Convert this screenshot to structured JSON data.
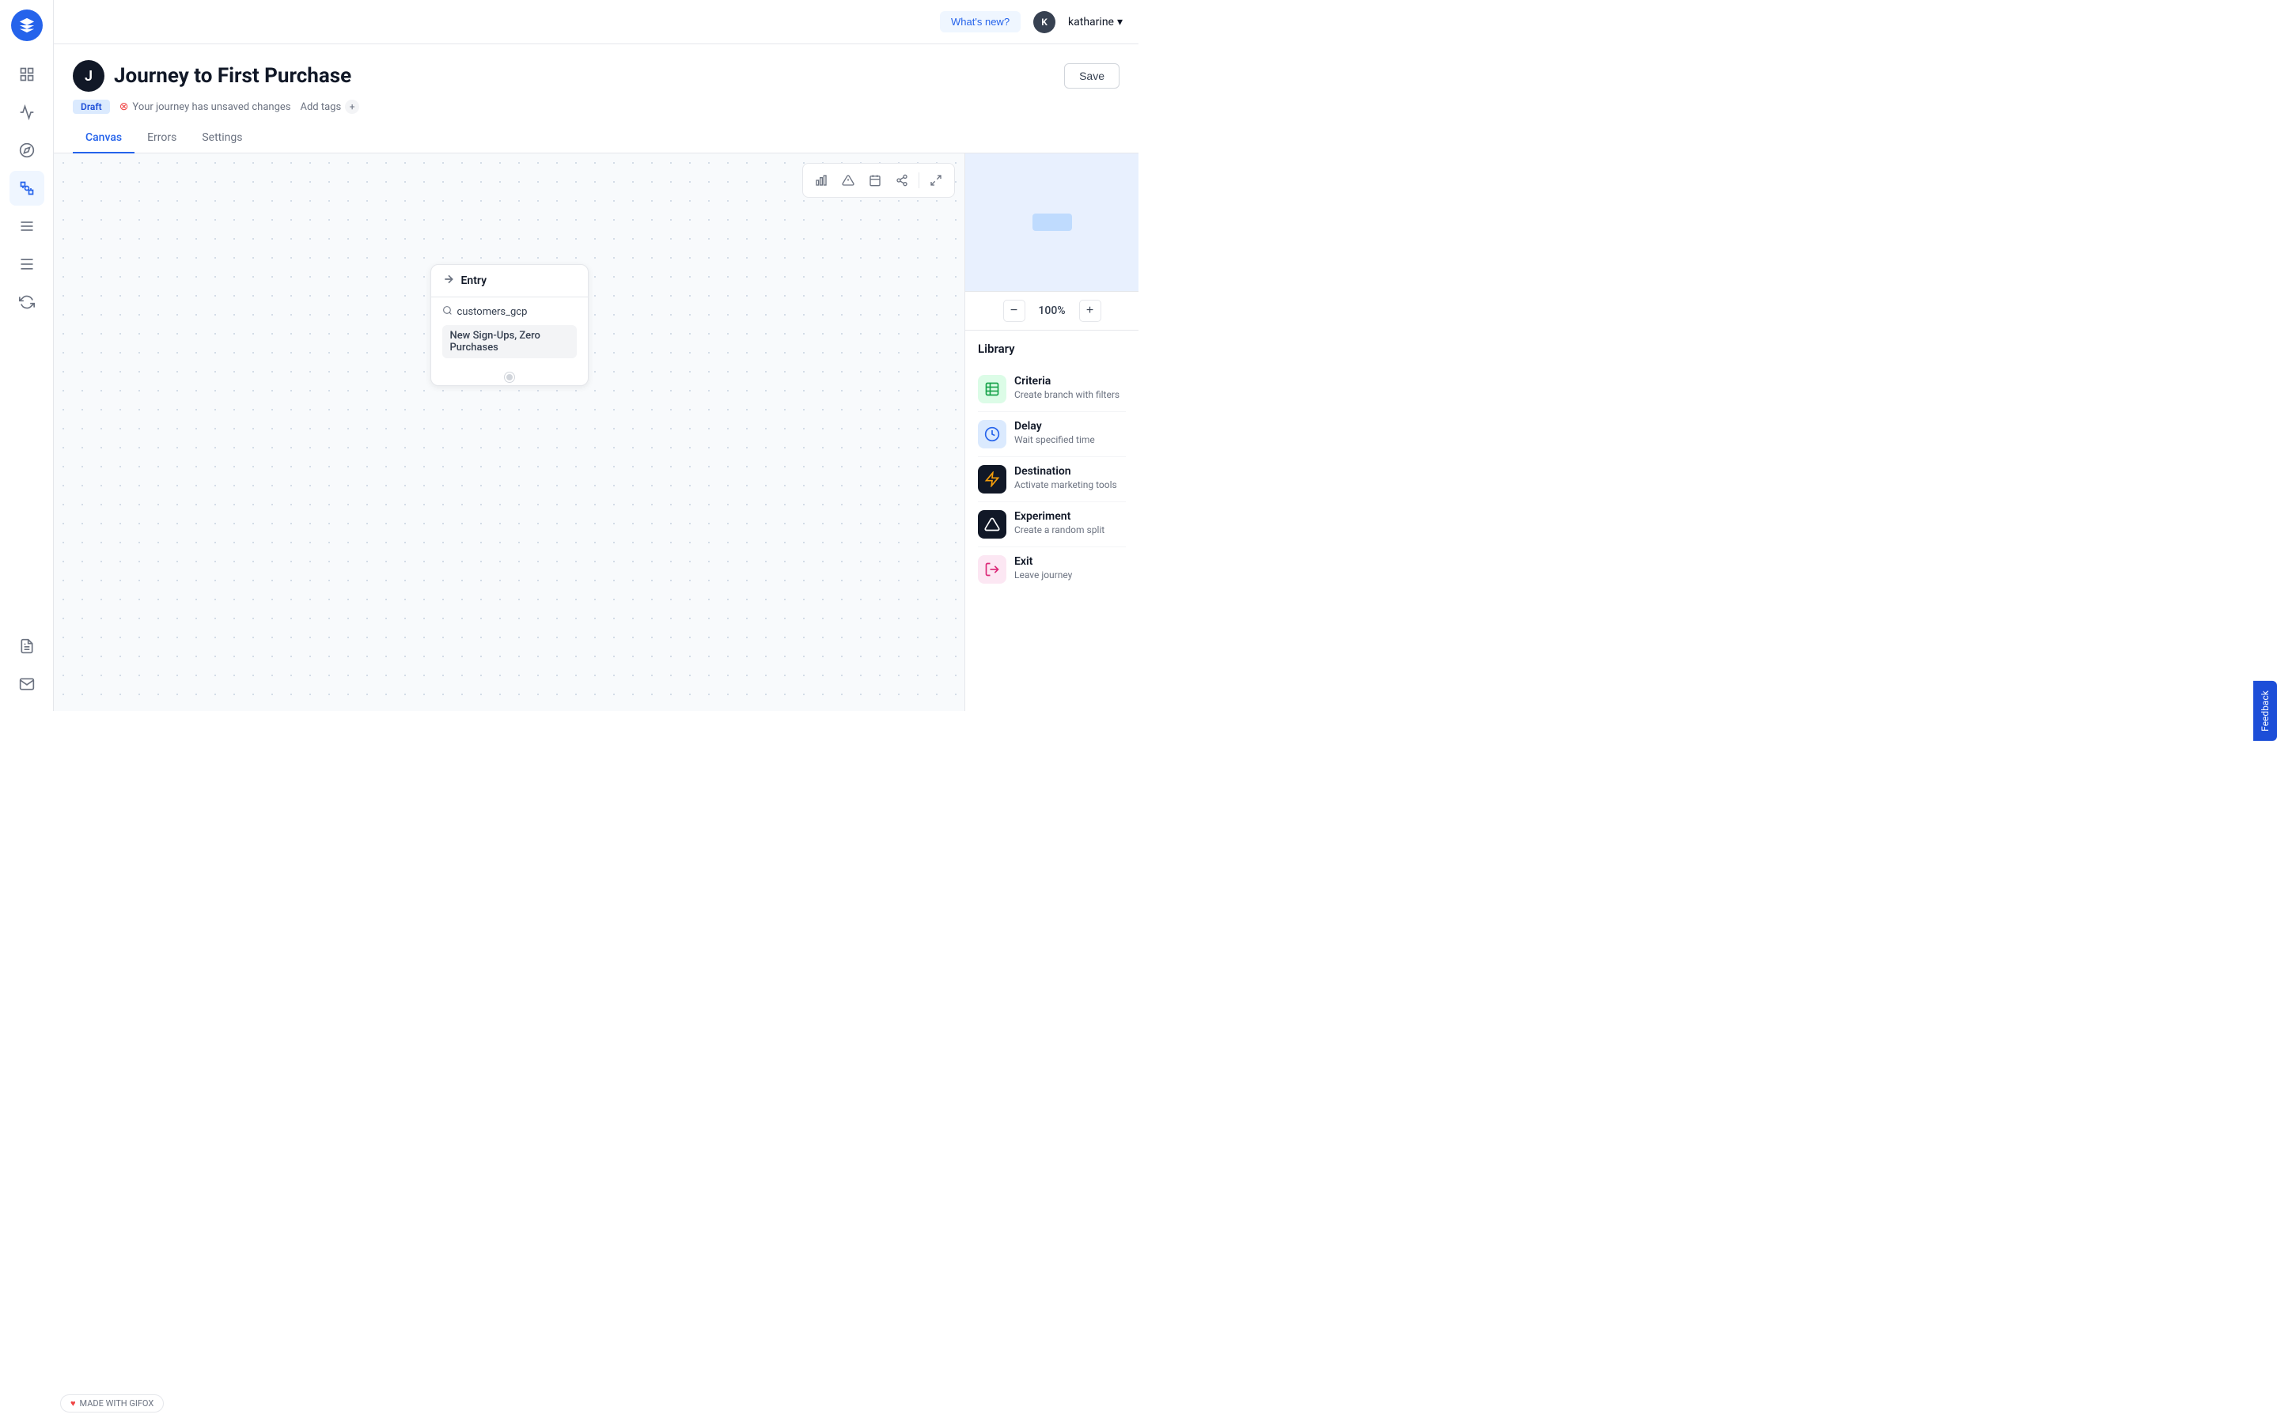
{
  "app": {
    "logo_letter": "★"
  },
  "topbar": {
    "whats_new_label": "What's new?",
    "user_initial": "K",
    "user_name": "katharine",
    "user_chevron": "▾"
  },
  "journey": {
    "icon_letter": "J",
    "title": "Journey to First Purchase",
    "save_label": "Save",
    "draft_label": "Draft",
    "unsaved_message": "Your journey has unsaved changes",
    "add_tags_label": "Add tags"
  },
  "nav": {
    "tabs": [
      {
        "id": "canvas",
        "label": "Canvas",
        "active": true
      },
      {
        "id": "errors",
        "label": "Errors",
        "active": false
      },
      {
        "id": "settings",
        "label": "Settings",
        "active": false
      }
    ]
  },
  "canvas_toolbar": {
    "bar_icon": "▦",
    "alert_icon": "▲",
    "calendar_icon": "▦",
    "share_icon": "⊡",
    "expand_icon": "⤢"
  },
  "entry_node": {
    "header_icon": "→",
    "header_label": "Entry",
    "segment_icon": "🔍",
    "segment_value": "customers_gcp",
    "audience_label": "New Sign-Ups, Zero Purchases"
  },
  "zoom": {
    "minus_label": "−",
    "level": "100%",
    "plus_label": "+"
  },
  "library": {
    "title": "Library",
    "items": [
      {
        "id": "criteria",
        "name": "Criteria",
        "description": "Create branch with filters",
        "icon": "≡",
        "icon_color": "green"
      },
      {
        "id": "delay",
        "name": "Delay",
        "description": "Wait specified time",
        "icon": "⏱",
        "icon_color": "blue"
      },
      {
        "id": "destination",
        "name": "Destination",
        "description": "Activate marketing tools",
        "icon": "⚡",
        "icon_color": "orange"
      },
      {
        "id": "experiment",
        "name": "Experiment",
        "description": "Create a random split",
        "icon": "▲",
        "icon_color": "dark"
      },
      {
        "id": "exit",
        "name": "Exit",
        "description": "Leave journey",
        "icon": "◻",
        "icon_color": "pink"
      }
    ]
  },
  "feedback": {
    "label": "Feedback"
  },
  "gifox": {
    "label": "MADE WITH GIFOX"
  },
  "sidebar": {
    "items": [
      {
        "id": "home",
        "icon": "⊞",
        "active": false
      },
      {
        "id": "signals",
        "icon": "◉",
        "active": false
      },
      {
        "id": "explore",
        "icon": "◎",
        "active": false
      },
      {
        "id": "journeys",
        "icon": "⌇",
        "active": true
      },
      {
        "id": "content",
        "icon": "☰",
        "active": false
      },
      {
        "id": "layers",
        "icon": "⊟",
        "active": false
      },
      {
        "id": "sync",
        "icon": "⇄",
        "active": false
      },
      {
        "id": "reports",
        "icon": "▦",
        "active": false
      },
      {
        "id": "messages",
        "icon": "✉",
        "active": false
      }
    ]
  }
}
